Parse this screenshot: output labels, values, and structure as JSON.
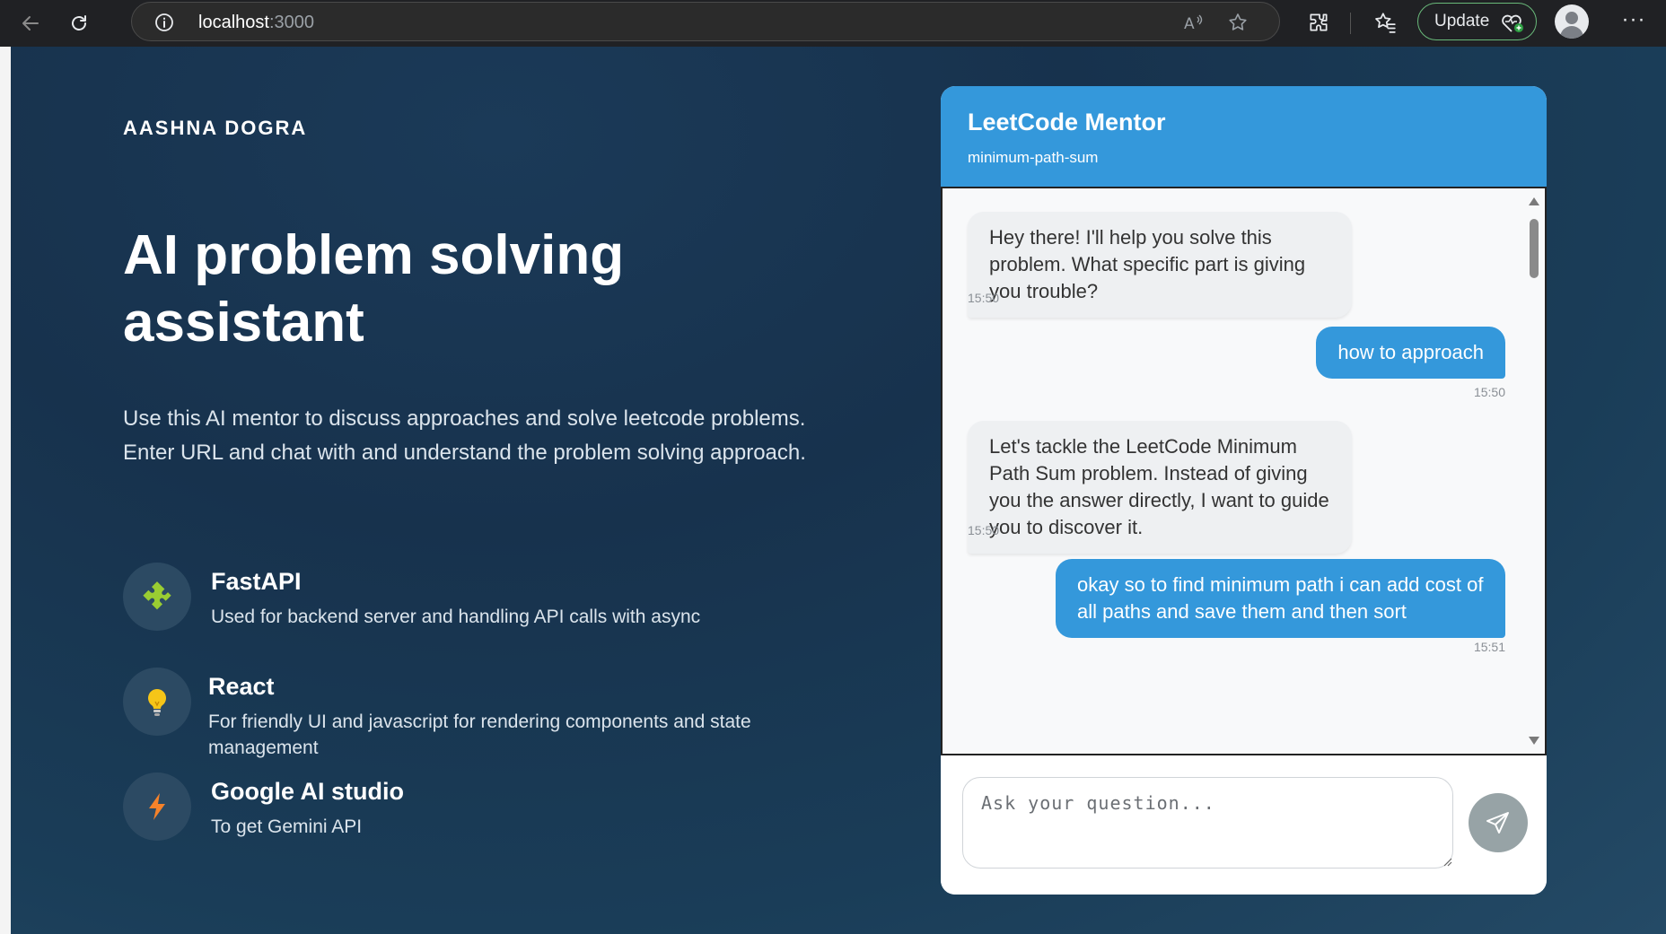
{
  "browser": {
    "url_host": "localhost",
    "url_port": ":3000",
    "update_label": "Update",
    "icons": [
      "back-icon",
      "reload-icon",
      "info-icon",
      "read-aloud-icon",
      "favorite-star-icon",
      "extensions-icon",
      "favorites-icon",
      "health-heart-icon",
      "profile-icon",
      "more-icon"
    ]
  },
  "page": {
    "brand": "AASHNA DOGRA",
    "hero_title": "AI problem solving assistant",
    "hero_desc_line1": "Use this AI mentor to discuss approaches and solve leetcode problems.",
    "hero_desc_line2": "Enter URL and chat with and understand the problem solving approach.",
    "features": [
      {
        "title": "FastAPI",
        "desc": "Used for backend server and handling API calls with async",
        "icon": "puzzle-icon",
        "color": "#9acd32"
      },
      {
        "title": "React",
        "desc": "For friendly UI and javascript for rendering components and state management",
        "icon": "lightbulb-icon",
        "color": "#f5c518"
      },
      {
        "title": "Google AI studio",
        "desc": "To get Gemini API",
        "icon": "lightning-icon",
        "color": "#f5822a"
      }
    ]
  },
  "chat": {
    "title": "LeetCode Mentor",
    "subtitle": "minimum-path-sum",
    "messages": [
      {
        "role": "bot",
        "text": "Hey there! I'll help you solve this problem. What specific part is giving you trouble?",
        "time": "15:50"
      },
      {
        "role": "user",
        "text": "how to approach",
        "time": "15:50"
      },
      {
        "role": "bot",
        "text": "Let's tackle the LeetCode Minimum Path Sum problem. Instead of giving you the answer directly, I want to guide you to discover it.",
        "time": "15:50"
      },
      {
        "role": "user",
        "text": "okay so to find minimum path i can add cost of all paths and save them and then sort",
        "time": "15:51"
      }
    ],
    "input_placeholder": "Ask your question...",
    "input_value": ""
  },
  "colors": {
    "accent": "#3498db",
    "send_button": "#97a3a6",
    "page_bg": "#17324d"
  }
}
